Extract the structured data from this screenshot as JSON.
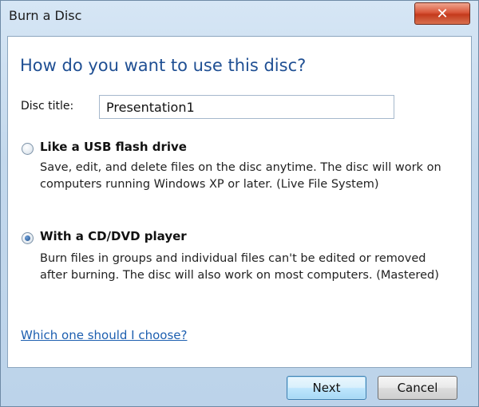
{
  "window": {
    "title": "Burn a Disc",
    "close_glyph": "✕"
  },
  "dialog": {
    "heading": "How do you want to use this disc?",
    "disc_title_label": "Disc title:",
    "disc_title_value": "Presentation1",
    "options": [
      {
        "label": "Like a USB flash drive",
        "selected": false,
        "description": "Save, edit, and delete files on the disc anytime. The disc will work on computers running Windows XP or later. (Live File System)"
      },
      {
        "label": "With a CD/DVD player",
        "selected": true,
        "description": "Burn files in groups and individual files can't be edited or removed after burning. The disc will also work on most computers. (Mastered)"
      }
    ],
    "help_link": "Which one should I choose?"
  },
  "buttons": {
    "next": "Next",
    "cancel": "Cancel"
  },
  "icons": {
    "close": "close-icon"
  },
  "colors": {
    "heading": "#1f4f93",
    "link": "#1d5fb0",
    "close_button": "#c43a1c"
  }
}
